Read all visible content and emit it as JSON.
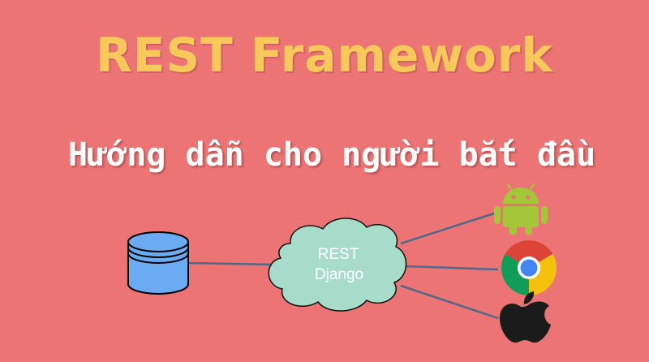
{
  "title": "REST Framework",
  "subtitle": "Hướng dẫn cho người bắt đầu",
  "cloud": {
    "line1": "REST",
    "line2": "Django"
  },
  "nodes": {
    "database": "database-icon",
    "android": "android-icon",
    "chrome": "chrome-icon",
    "apple": "apple-icon"
  },
  "colors": {
    "background": "#ec7475",
    "title": "#f7c85a",
    "database": "#6aabf2",
    "cloud": "#a7dccb",
    "connector": "#4d6a8a",
    "android": "#a4c73a"
  }
}
